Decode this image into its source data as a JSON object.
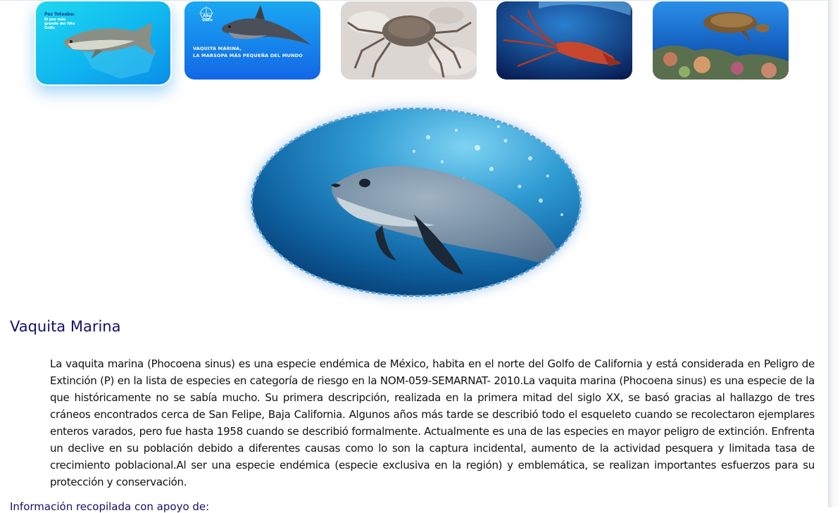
{
  "gallery": {
    "thumbnails": [
      {
        "title": "Pez Totoaba:",
        "caption": "El pez más grande del Alto Golfo",
        "selected": true
      },
      {
        "logo": "Alto Golfo",
        "caption_line1": "VAQUITA MARINA,",
        "caption_line2": "LA MARSOPA MÁS PEQUEÑA DEL MUNDO"
      },
      {
        "subject": "crab"
      },
      {
        "subject": "squid"
      },
      {
        "subject": "sea-turtle"
      }
    ]
  },
  "hero": {
    "subject": "vaquita-marina-photo",
    "border_color": "#5aa3d6"
  },
  "article": {
    "heading": "Vaquita Marina",
    "body": "La vaquita marina (Phocoena sinus) es una especie endémica de México, habita en el norte del Golfo de California y está considerada en Peligro de Extinción (P) en la lista de especies en categoría de riesgo en la NOM-059-SEMARNAT- 2010.La vaquita marina (Phocoena sinus) es una especie de la que históricamente no se sabía mucho. Su primera descripción, realizada en la primera mitad del siglo XX, se basó gracias al hallazgo de tres cráneos encontrados cerca de San Felipe, Baja California. Algunos años más tarde se describió todo el esqueleto cuando se recolectaron ejemplares enteros varados, pero fue hasta 1958 cuando se describió formalmente. Actualmente es una de las especies en mayor peligro de extinción. Enfrenta un declive en su población debido a diferentes causas como lo son la captura incidental, aumento de la actividad pesquera y limitada tasa de crecimiento poblacional.Al ser una especie endémica (especie exclusiva en la región) y emblemática, se realizan importantes esfuerzos para su protección y conservación.",
    "next_link": "Información recopilada con apoyo de:"
  },
  "colors": {
    "heading": "#11116b",
    "body": "#111111",
    "accent": "#0aa4f0"
  }
}
